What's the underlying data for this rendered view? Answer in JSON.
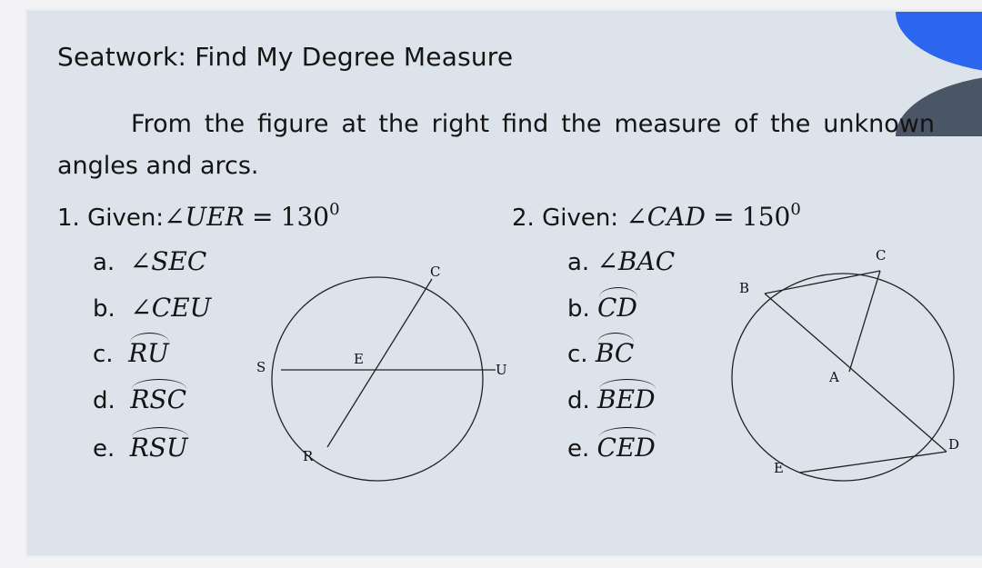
{
  "slide": {
    "title": "Seatwork: Find My Degree Measure",
    "instructions": "From the figure at the right find the measure of the unknown angles and arcs."
  },
  "problem1": {
    "number": "1.",
    "given_label": "Given:",
    "given_angle": "∠UER",
    "equals": "=",
    "given_value": "130",
    "degree_mark": "0",
    "items": [
      {
        "letter": "a.",
        "expr": "∠SEC",
        "type": "angle"
      },
      {
        "letter": "b.",
        "expr": "∠CEU",
        "type": "angle"
      },
      {
        "letter": "c.",
        "expr": "RU",
        "type": "arc"
      },
      {
        "letter": "d.",
        "expr": "RSC",
        "type": "arc"
      },
      {
        "letter": "e.",
        "expr": "RSU",
        "type": "arc"
      }
    ],
    "figure_labels": {
      "S": "S",
      "E": "E",
      "U": "U",
      "C": "C",
      "R": "R"
    }
  },
  "problem2": {
    "number": "2.",
    "given_label": "Given:",
    "given_angle": "∠CAD",
    "equals": "=",
    "given_value": "150",
    "degree_mark": "0",
    "items": [
      {
        "letter": "a.",
        "expr": "∠BAC",
        "type": "angle"
      },
      {
        "letter": "b.",
        "expr": "CD",
        "type": "arc"
      },
      {
        "letter": "c.",
        "expr": "BC",
        "type": "arc"
      },
      {
        "letter": "d.",
        "expr": "BED",
        "type": "arc"
      },
      {
        "letter": "e.",
        "expr": "CED",
        "type": "arc"
      }
    ],
    "figure_labels": {
      "B": "B",
      "C": "C",
      "A": "A",
      "D": "D",
      "E": "E"
    }
  },
  "colors": {
    "slide_bg": "#dce3eb",
    "accent_blue": "#2a67ee",
    "accent_gray": "#4a5566",
    "text": "#141414"
  }
}
